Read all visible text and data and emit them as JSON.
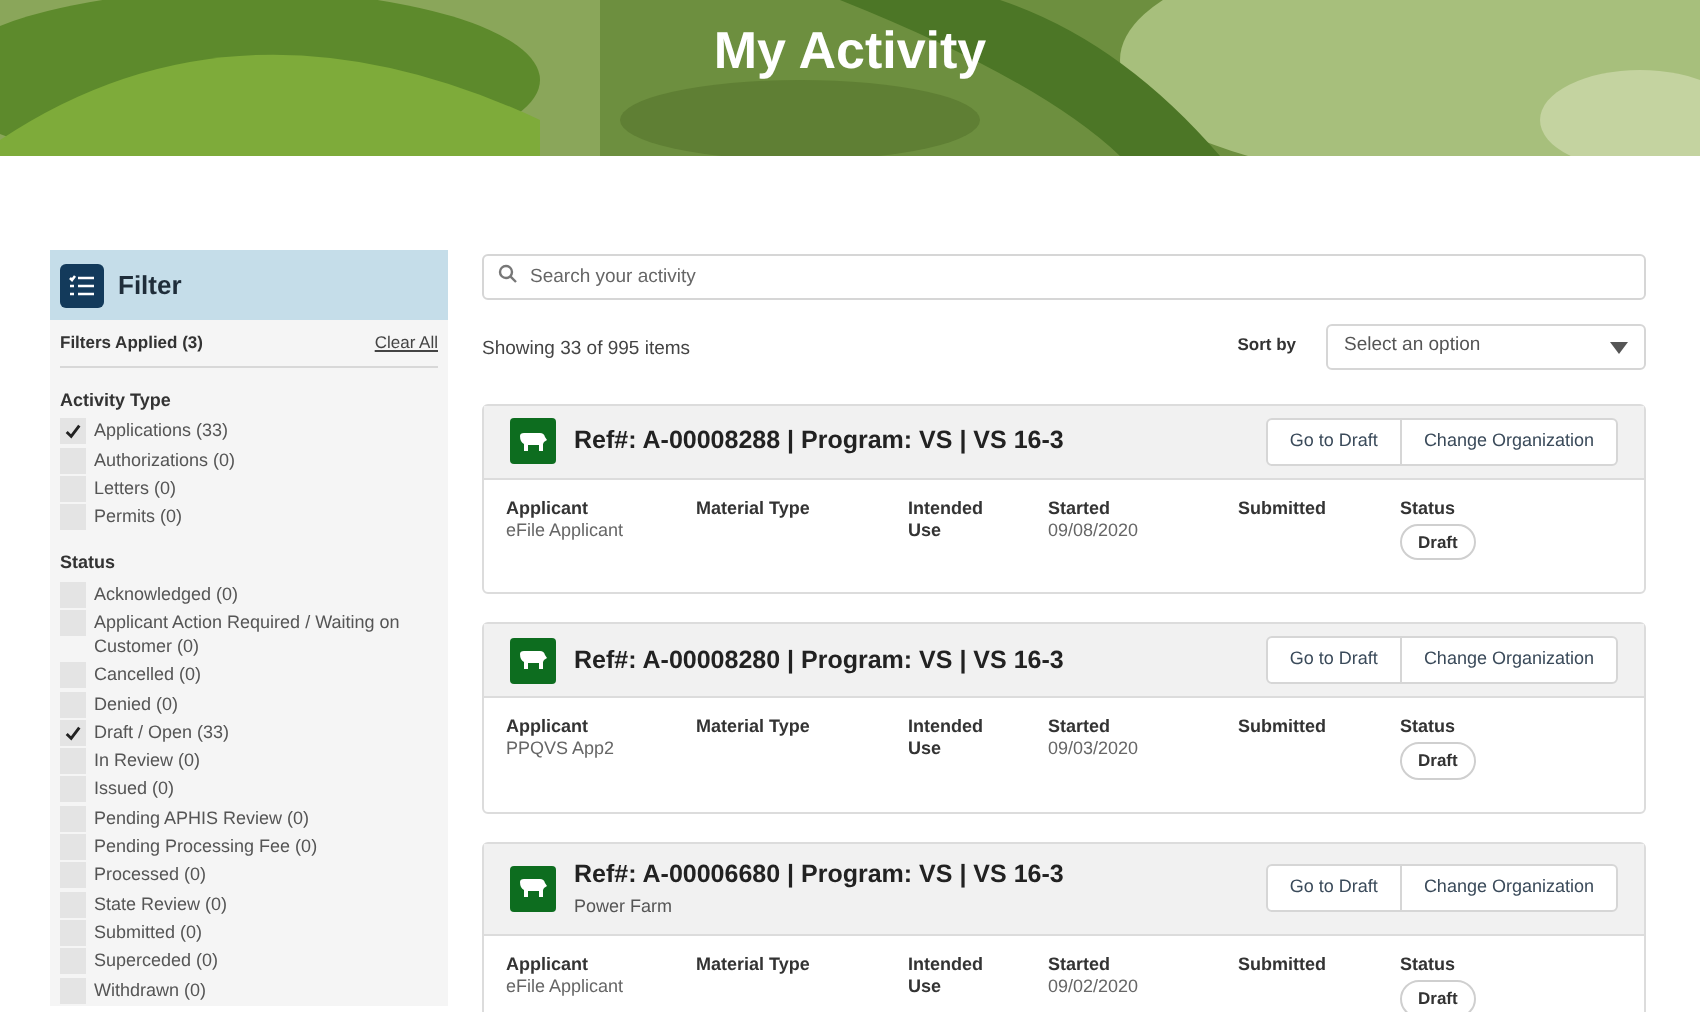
{
  "banner": {
    "title": "My Activity"
  },
  "filter": {
    "title": "Filter",
    "applied": "Filters Applied (3)",
    "clear": "Clear All",
    "groups": [
      {
        "title": "Activity Type",
        "options": [
          {
            "label": "Applications (33)",
            "checked": true
          },
          {
            "label": "Authorizations (0)",
            "checked": false
          },
          {
            "label": "Letters (0)",
            "checked": false
          },
          {
            "label": "Permits (0)",
            "checked": false
          }
        ]
      },
      {
        "title": "Status",
        "options": [
          {
            "label": "Acknowledged (0)",
            "checked": false
          },
          {
            "label": "Applicant Action Required / Waiting on Customer (0)",
            "checked": false
          },
          {
            "label": "Cancelled (0)",
            "checked": false
          },
          {
            "label": "Denied (0)",
            "checked": false
          },
          {
            "label": "Draft / Open (33)",
            "checked": true
          },
          {
            "label": "In Review (0)",
            "checked": false
          },
          {
            "label": "Issued (0)",
            "checked": false
          },
          {
            "label": "Pending APHIS Review (0)",
            "checked": false
          },
          {
            "label": "Pending Processing Fee (0)",
            "checked": false
          },
          {
            "label": "Processed (0)",
            "checked": false
          },
          {
            "label": "State Review (0)",
            "checked": false
          },
          {
            "label": "Submitted (0)",
            "checked": false
          },
          {
            "label": "Superceded (0)",
            "checked": false
          },
          {
            "label": "Withdrawn (0)",
            "checked": false
          }
        ]
      }
    ]
  },
  "search": {
    "placeholder": "Search your activity"
  },
  "results": {
    "count": "Showing 33 of 995 items",
    "sort_label": "Sort by",
    "sort_placeholder": "Select an option"
  },
  "cards": [
    {
      "title": "Ref#: A-00008288 | Program: VS | VS 16-3",
      "actions": [
        "Go to Draft",
        "Change Organization"
      ],
      "fields": [
        {
          "label": "Applicant",
          "value": "eFile Applicant"
        },
        {
          "label": "Material Type"
        },
        {
          "label": "Intended Use"
        },
        {
          "label": "Started",
          "value": "09/08/2020"
        },
        {
          "label": "Submitted"
        },
        {
          "label": "Status",
          "badge": "Draft"
        }
      ]
    },
    {
      "title": "Ref#: A-00008280 | Program: VS | VS 16-3",
      "actions": [
        "Go to Draft",
        "Change Organization"
      ],
      "fields": [
        {
          "label": "Applicant",
          "value": "PPQVS App2"
        },
        {
          "label": "Material Type"
        },
        {
          "label": "Intended Use"
        },
        {
          "label": "Started",
          "value": "09/03/2020"
        },
        {
          "label": "Submitted"
        },
        {
          "label": "Status",
          "badge": "Draft"
        }
      ]
    },
    {
      "title": "Ref#: A-00006680 | Program: VS | VS 16-3",
      "subtitle": "Power Farm",
      "actions": [
        "Go to Draft",
        "Change Organization"
      ],
      "fields": [
        {
          "label": "Applicant",
          "value": "eFile Applicant"
        },
        {
          "label": "Material Type"
        },
        {
          "label": "Intended Use"
        },
        {
          "label": "Started",
          "value": "09/02/2020"
        },
        {
          "label": "Submitted"
        },
        {
          "label": "Status",
          "badge": "Draft"
        }
      ]
    }
  ]
}
